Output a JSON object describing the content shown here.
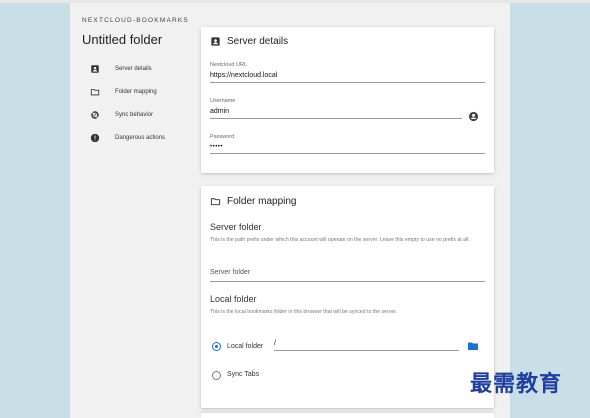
{
  "sidebar": {
    "app_name": "NEXTCLOUD-BOOKMARKS",
    "folder_title": "Untitled folder",
    "items": [
      {
        "label": "Server details",
        "icon": "account-box-icon"
      },
      {
        "label": "Folder mapping",
        "icon": "folder-icon"
      },
      {
        "label": "Sync behavior",
        "icon": "sync-off-icon"
      },
      {
        "label": "Dangerous actions",
        "icon": "alert-circle-icon"
      }
    ]
  },
  "server_details": {
    "title": "Server details",
    "url": {
      "label": "Nextcloud URL",
      "value": "https://nextcloud.local"
    },
    "username": {
      "label": "Username",
      "value": "admin"
    },
    "password": {
      "label": "Password",
      "value": "•••••"
    }
  },
  "folder_mapping": {
    "title": "Folder mapping",
    "server_folder": {
      "heading": "Server folder",
      "description": "This is the path prefix under which this account will operate on the server. Leave this empty to use no prefix at all.",
      "placeholder": "Server folder"
    },
    "local_folder": {
      "heading": "Local folder",
      "description": "This is the local bookmarks folder in this browser that will be synced to the server.",
      "options": [
        {
          "label": "Local folder",
          "value": "/",
          "checked": true
        },
        {
          "label": "Sync Tabs",
          "checked": false
        }
      ]
    }
  },
  "colors": {
    "accent": "#1a73c8",
    "page_bg": "#c9dfe8",
    "panel_bg": "#f1f1f1"
  },
  "watermark": "最需教育"
}
